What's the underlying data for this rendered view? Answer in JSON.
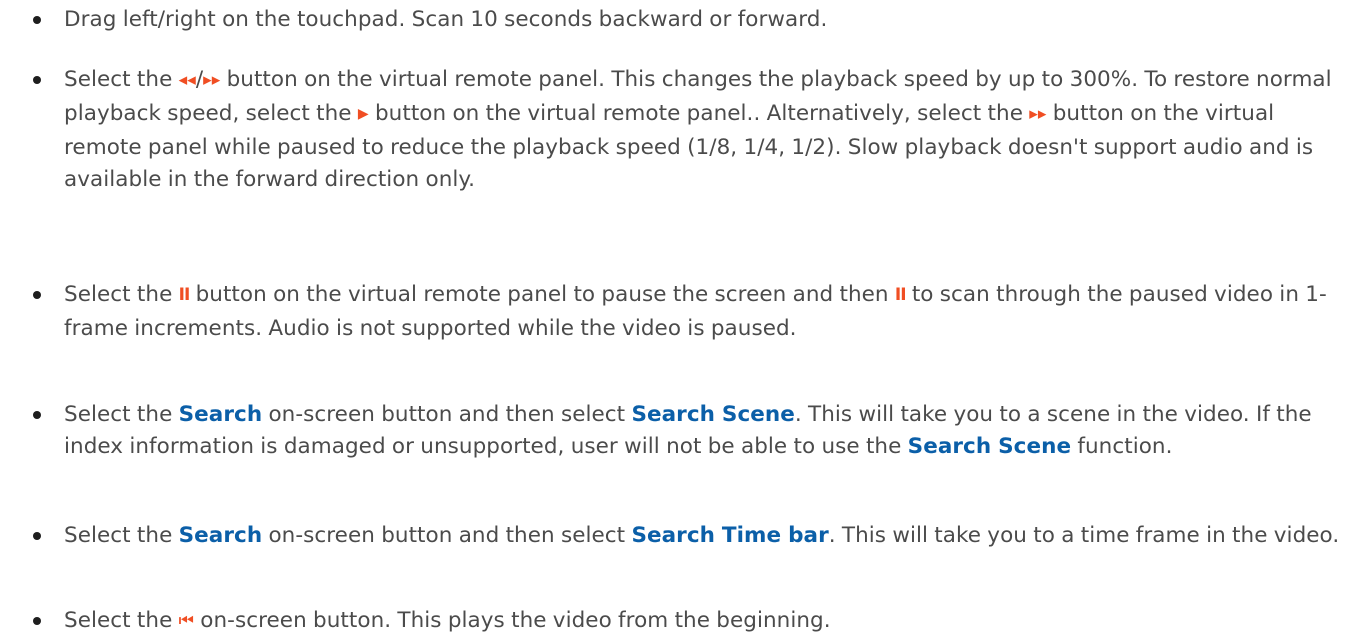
{
  "colors": {
    "body_text": "#4b4b4b",
    "keyword": "#0b5fa8",
    "button_glyph": "#f04e23",
    "bullet": "#1e1e1e"
  },
  "items": [
    {
      "text": "Drag left/right on the touchpad. Scan 10 seconds backward or forward."
    },
    {
      "t1": "Select the ",
      "glyph_rewind": "◂◂",
      "slash": "/",
      "glyph_ff": "▸▸",
      "t2": " button on the virtual remote panel. This changes the playback speed by up to 300%. To restore normal playback speed, select the ",
      "glyph_play": "▶",
      "t3": " button on the virtual remote panel.. Alternatively, select the ",
      "glyph_ff2": "▸▸",
      "t4": " button on the virtual remote panel while paused to reduce the playback speed (1/8, 1/4, 1/2). Slow playback doesn't support audio and is available in the forward direction only."
    },
    {
      "t1": "Select the ",
      "glyph_pause": "II",
      "t2": " button on the virtual remote panel to pause the screen and then ",
      "glyph_pause2": "II",
      "t3": " to scan through the paused video in 1-frame increments. Audio is not supported while the video is paused."
    },
    {
      "t1": "Select the ",
      "kw1": "Search",
      "t2": " on-screen button and then select ",
      "kw2": "Search Scene",
      "t3": ". This will take you to a scene in the video. If the index information is damaged or unsupported, user will not be able to use the ",
      "kw3": "Search Scene",
      "t4": " function."
    },
    {
      "t1": "Select the ",
      "kw1": "Search",
      "t2": " on-screen button and then select ",
      "kw2": "Search Time bar",
      "t3": ". This will take you to a time frame in the video."
    },
    {
      "t1": "Select the ",
      "glyph_skipback": "⏮",
      "t2": " on-screen button. This plays the video from the beginning."
    }
  ]
}
